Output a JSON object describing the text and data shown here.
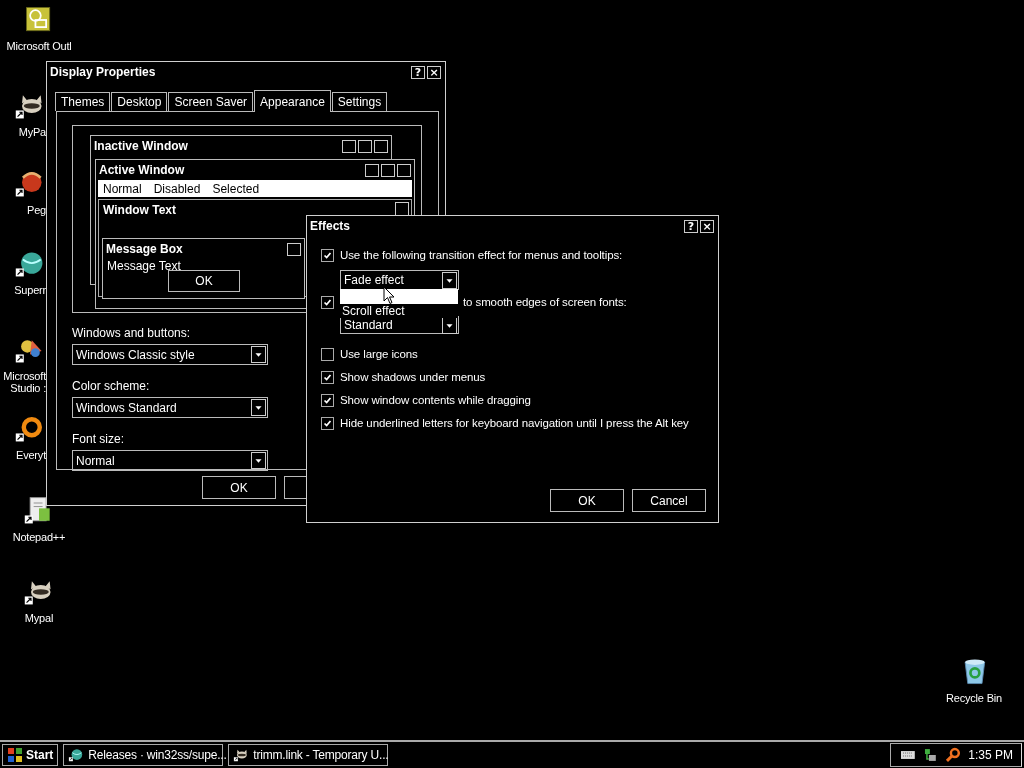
{
  "desktop_icons": [
    {
      "label": "Microsoft Outl",
      "kind": "clock"
    },
    {
      "label": "MyPa",
      "kind": "raccoon"
    },
    {
      "label": "Peg",
      "kind": "ball"
    },
    {
      "label": "Superr",
      "kind": "globe"
    },
    {
      "label": "Microsoft Studio :",
      "kind": "shapes"
    },
    {
      "label": "Everyt",
      "kind": "ring"
    },
    {
      "label": "Notepad++",
      "kind": "notepad"
    },
    {
      "label": "Mypal",
      "kind": "raccoon"
    },
    {
      "label": "Recycle Bin",
      "kind": "bin"
    }
  ],
  "display_properties": {
    "title": "Display Properties",
    "title_buttons": [
      "?",
      "×"
    ],
    "tabs": [
      {
        "label": "Themes",
        "selected": false
      },
      {
        "label": "Desktop",
        "selected": false
      },
      {
        "label": "Screen Saver",
        "selected": false
      },
      {
        "label": "Appearance",
        "selected": true
      },
      {
        "label": "Settings",
        "selected": false
      }
    ],
    "preview": {
      "inactive_title": "Inactive Window",
      "active_title": "Active Window",
      "menu_items": [
        "Normal",
        "Disabled",
        "Selected"
      ],
      "window_text": "Window Text",
      "message_box": {
        "title": "Message Box",
        "text": "Message Text",
        "button": "OK"
      }
    },
    "fields": [
      {
        "label": "Windows and buttons:",
        "value": "Windows Classic style"
      },
      {
        "label": "Color scheme:",
        "value": "Windows Standard"
      },
      {
        "label": "Font size:",
        "value": "Normal"
      }
    ],
    "buttons": [
      "OK"
    ]
  },
  "effects": {
    "title": "Effects",
    "title_buttons": [
      "?",
      "×"
    ],
    "transition": {
      "checked": true,
      "label": "Use the following transition effect for menus and tooltips:",
      "value": "Fade effect",
      "list_highlight": true,
      "options": [
        {
          "label": "Scroll effect",
          "selected": false
        }
      ]
    },
    "smoothing": {
      "checked": true,
      "label": "to smooth edges of screen fonts:",
      "value": "Standard"
    },
    "options": [
      {
        "label": "Use large icons",
        "checked": false
      },
      {
        "label": "Show shadows under menus",
        "checked": true
      },
      {
        "label": "Show window contents while dragging",
        "checked": true
      },
      {
        "label": "Hide underlined letters for keyboard navigation until I press the Alt key",
        "checked": true
      }
    ],
    "buttons": [
      "OK",
      "Cancel"
    ]
  },
  "taskbar": {
    "start": "Start",
    "tasks": [
      {
        "label": "Releases · win32ss/supe...",
        "kind": "globe"
      },
      {
        "label": "trimm.link - Temporary U...",
        "kind": "raccoon"
      }
    ],
    "clock": "1:35 PM"
  }
}
